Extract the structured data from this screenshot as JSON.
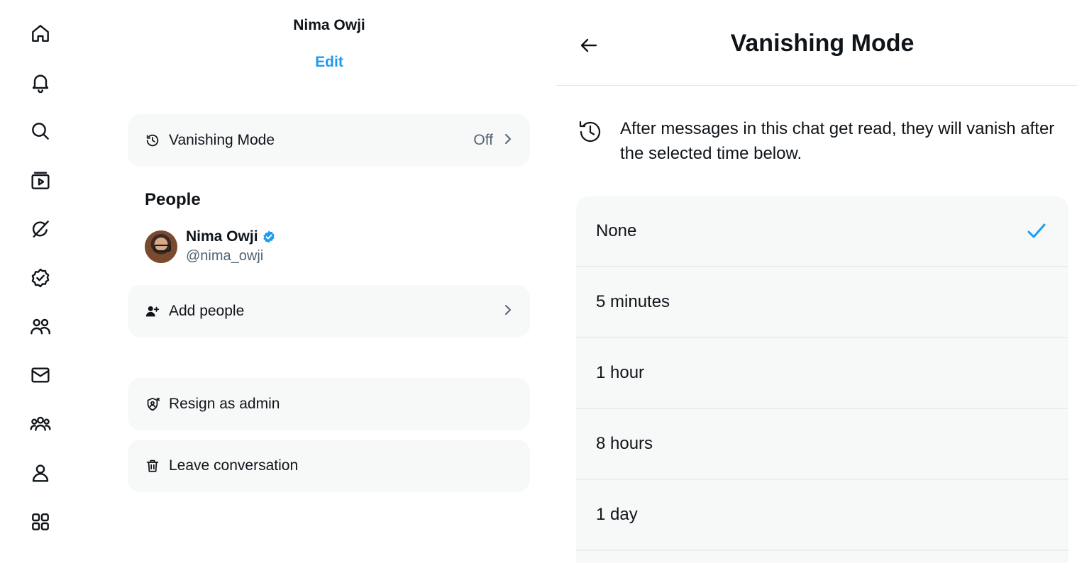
{
  "nav_rail": {
    "icons": [
      "home-icon",
      "notifications-icon",
      "search-icon",
      "video-icon",
      "grok-icon",
      "verified-icon",
      "communities-icon",
      "messages-icon",
      "groups-icon",
      "profile-icon",
      "more-icon"
    ]
  },
  "details": {
    "chat_name": "Nima Owji",
    "edit_label": "Edit",
    "vanishing": {
      "label": "Vanishing Mode",
      "value": "Off"
    },
    "people_heading": "People",
    "member": {
      "name": "Nima Owji",
      "handle": "@nima_owji"
    },
    "add_people_label": "Add people",
    "resign_label": "Resign as admin",
    "leave_label": "Leave conversation"
  },
  "vanishing_panel": {
    "title": "Vanishing Mode",
    "description": "After messages in this chat get read, they will vanish after the selected time below.",
    "options": [
      {
        "label": "None",
        "selected": true
      },
      {
        "label": "5 minutes",
        "selected": false
      },
      {
        "label": "1 hour",
        "selected": false
      },
      {
        "label": "8 hours",
        "selected": false
      },
      {
        "label": "1 day",
        "selected": false
      }
    ]
  },
  "colors": {
    "accent": "#1d9bf0",
    "text": "#0f1419",
    "muted": "#536471",
    "card_bg": "#f7f9f9"
  }
}
